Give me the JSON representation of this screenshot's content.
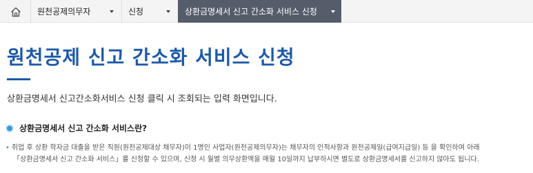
{
  "breadcrumb": {
    "home_icon": "home-icon",
    "items": [
      {
        "label": "원천공제의무자"
      },
      {
        "label": "신청"
      },
      {
        "label": "상환금명세서 신고 간소화 서비스 신청"
      }
    ]
  },
  "page": {
    "title": "원천공제 신고 간소화 서비스 신청",
    "subtitle": "상환금명세서 신고간소화서비스 신청 클릭 시 조회되는 입력 화면입니다."
  },
  "section": {
    "heading": "상환금명세서 신고 간소화 서비스란?",
    "line1": "취업 후 상환 학자금 대출을 받은 직원(원천공제대상 채무자)이 1명인 사업자(원천공제의무자)는 채무자의 인적사항과 원천공제일(급여지급일) 등 을 확인하여 아래",
    "line2": "「상환금명세서 신고 간소화 서비스」를 신청할 수 있으며, 신청 시 월별 의무상환액을 매월 10일까지 납부하시면 별도로 상환금명세서를 신고하지 않아도 됩니다."
  },
  "colors": {
    "accent": "#1d5aa8",
    "active_crumb_bg": "#555d6b",
    "bullet": "#2f9be3"
  }
}
